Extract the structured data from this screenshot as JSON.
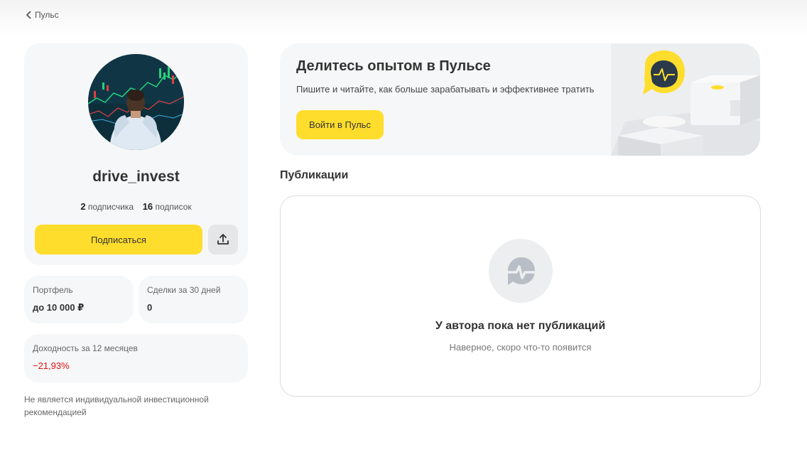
{
  "nav": {
    "back_label": "Пульс"
  },
  "profile": {
    "username": "drive_invest",
    "followers_count": "2",
    "followers_label": "подписчика",
    "following_count": "16",
    "following_label": "подписок",
    "subscribe_label": "Подписаться"
  },
  "stats": {
    "portfolio_label": "Портфель",
    "portfolio_value": "до 10 000 ₽",
    "deals_label": "Сделки за 30 дней",
    "deals_value": "0",
    "yield_label": "Доходность за 12 месяцев",
    "yield_value": "−21,93%"
  },
  "disclaimer": "Не является индивидуальной инвестиционной рекомендацией",
  "banner": {
    "title": "Делитесь опытом в Пульсе",
    "subtitle": "Пишите и читайте, как больше зарабатывать и эффективнее тратить",
    "button_label": "Войти в Пульс"
  },
  "publications": {
    "section_title": "Публикации",
    "empty_title": "У автора пока нет публикаций",
    "empty_subtitle": "Наверное, скоро что-то появится"
  },
  "colors": {
    "accent": "#ffdd2d",
    "negative": "#dd1111",
    "card_bg": "#f6f7f8"
  }
}
